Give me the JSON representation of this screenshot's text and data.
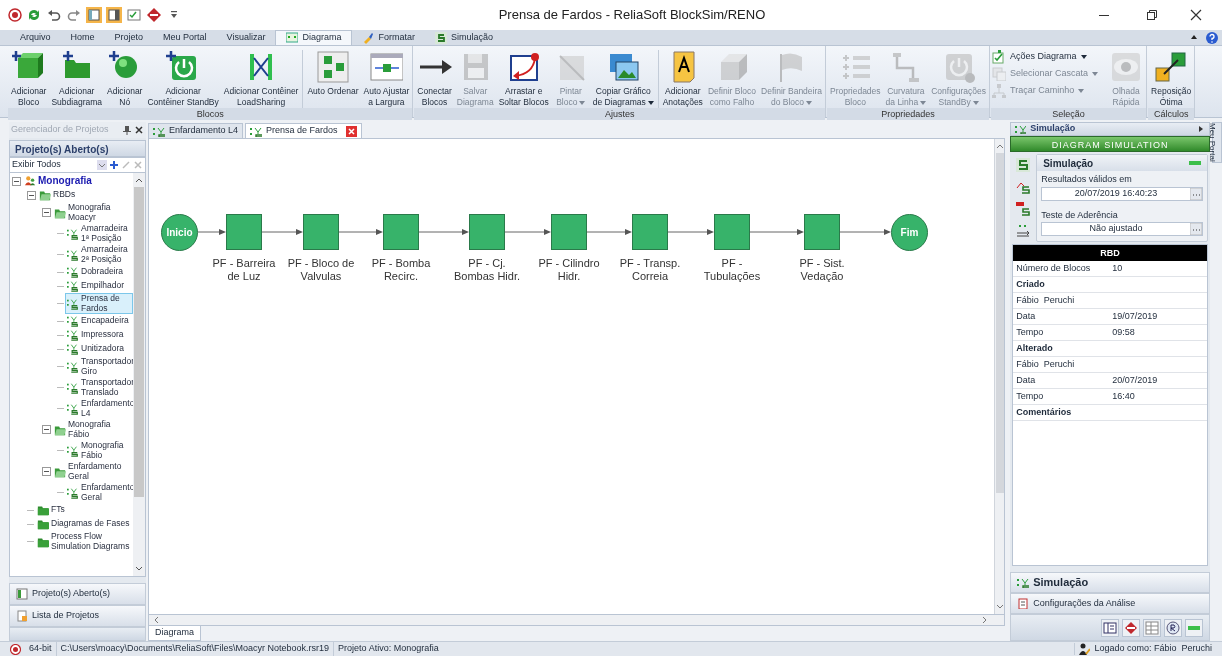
{
  "window": {
    "title": "Prensa de Fardos - ReliaSoft BlockSim/RENO"
  },
  "menu_tabs": [
    {
      "label": "Arquivo",
      "selected": false
    },
    {
      "label": "Home",
      "selected": false
    },
    {
      "label": "Projeto",
      "selected": false
    },
    {
      "label": "Meu Portal",
      "selected": false
    },
    {
      "label": "Visualizar",
      "selected": false
    },
    {
      "label": "Diagrama",
      "selected": true
    },
    {
      "label": "Formatar",
      "selected": false
    },
    {
      "label": "Simulação",
      "selected": false
    }
  ],
  "ribbon": [
    {
      "label": "Blocos",
      "buttons": [
        {
          "kind": "large",
          "label": "Adicionar\nBloco",
          "disabled": false,
          "dropdown": false
        },
        {
          "kind": "large",
          "label": "Adicionar\nSubdiagrama",
          "disabled": false,
          "dropdown": false
        },
        {
          "kind": "large",
          "label": "Adicionar\nNó",
          "disabled": false,
          "dropdown": false
        },
        {
          "kind": "large",
          "label": "Adicionar\nContêiner StandBy",
          "disabled": false,
          "dropdown": false
        },
        {
          "kind": "large",
          "label": "Adicionar Contêiner\nLoadSharing",
          "disabled": false,
          "dropdown": false
        },
        {
          "kind": "large",
          "label": "Auto Ordenar",
          "disabled": false,
          "dropdown": false
        },
        {
          "kind": "large",
          "label": "Auto Ajustar\na Largura",
          "disabled": false,
          "dropdown": false
        }
      ]
    },
    {
      "label": "Ajustes",
      "buttons": [
        {
          "kind": "large",
          "label": "Conectar\nBlocos",
          "disabled": false,
          "dropdown": false
        },
        {
          "kind": "large",
          "label": "Salvar\nDiagrama",
          "disabled": true,
          "dropdown": false
        },
        {
          "kind": "large",
          "label": "Arrastar e\nSoltar Blocos",
          "disabled": false,
          "dropdown": false
        },
        {
          "kind": "large",
          "label": "Pintar\nBloco",
          "disabled": true,
          "dropdown": true
        },
        {
          "kind": "large",
          "label": "Copiar Gráfico\nde Diagramas",
          "disabled": false,
          "dropdown": true
        },
        {
          "kind": "large",
          "label": "Adicionar\nAnotações",
          "disabled": false,
          "dropdown": false
        },
        {
          "kind": "large",
          "label": "Definir Bloco\ncomo Falho",
          "disabled": true,
          "dropdown": false
        },
        {
          "kind": "large",
          "label": "Definir Bandeira\ndo Bloco",
          "disabled": true,
          "dropdown": true
        }
      ]
    },
    {
      "label": "Propriedades",
      "buttons": [
        {
          "kind": "large",
          "label": "Propriedades\nBloco",
          "disabled": true,
          "dropdown": false
        },
        {
          "kind": "large",
          "label": "Curvatura\nda Linha",
          "disabled": true,
          "dropdown": true
        },
        {
          "kind": "large",
          "label": "Configurações\nStandBy",
          "disabled": true,
          "dropdown": true
        }
      ]
    },
    {
      "label": "Seleção",
      "buttons": [
        {
          "kind": "small",
          "label": "Ações Diagrama",
          "disabled": false,
          "dropdown": true
        },
        {
          "kind": "small",
          "label": "Selecionar Cascata",
          "disabled": true,
          "dropdown": true
        },
        {
          "kind": "small",
          "label": "Traçar Caminho",
          "disabled": true,
          "dropdown": true
        },
        {
          "kind": "large",
          "label": "Olhada\nRápida",
          "disabled": true,
          "dropdown": false
        }
      ]
    },
    {
      "label": "Cálculos",
      "buttons": [
        {
          "kind": "large",
          "label": "Reposição\nÓtima",
          "disabled": false,
          "dropdown": false
        }
      ]
    }
  ],
  "project_panel": {
    "title": "Gerenciador de Projetos",
    "header": "Projeto(s) Aberto(s)",
    "filter": "Exibir Todos",
    "tree": [
      {
        "label": "Monografia",
        "kind": "project",
        "expanded": true,
        "selected": false,
        "children": [
          {
            "label": "RBDs",
            "kind": "folder",
            "expanded": true,
            "selected": false,
            "children": [
              {
                "label": "Monografia Moacyr",
                "kind": "folder",
                "expanded": true,
                "selected": false,
                "children": [
                  {
                    "label": "Amarradeira 1ª Posição",
                    "kind": "diagram",
                    "selected": false
                  },
                  {
                    "label": "Amarradeira 2ª Posição",
                    "kind": "diagram",
                    "selected": false
                  },
                  {
                    "label": "Dobradeira",
                    "kind": "diagram",
                    "selected": false
                  },
                  {
                    "label": "Empilhador",
                    "kind": "diagram",
                    "selected": false
                  },
                  {
                    "label": "Prensa de Fardos",
                    "kind": "diagram",
                    "selected": true
                  },
                  {
                    "label": "Encapadeira",
                    "kind": "diagram",
                    "selected": false
                  },
                  {
                    "label": "Impressora",
                    "kind": "diagram",
                    "selected": false
                  },
                  {
                    "label": "Unitizadora",
                    "kind": "diagram",
                    "selected": false
                  },
                  {
                    "label": "Transportador Giro",
                    "kind": "diagram",
                    "selected": false
                  },
                  {
                    "label": "Transportador Translado",
                    "kind": "diagram",
                    "selected": false
                  },
                  {
                    "label": "Enfardamento L4",
                    "kind": "diagram",
                    "selected": false
                  }
                ]
              },
              {
                "label": "Monografia Fábio",
                "kind": "folder",
                "expanded": true,
                "selected": false,
                "children": [
                  {
                    "label": "Monografia Fábio",
                    "kind": "diagram",
                    "selected": false
                  }
                ]
              },
              {
                "label": "Enfardamento Geral",
                "kind": "folder",
                "expanded": true,
                "selected": false,
                "children": [
                  {
                    "label": "Enfardamento Geral",
                    "kind": "diagram",
                    "selected": false
                  }
                ]
              }
            ]
          },
          {
            "label": "FTs",
            "kind": "group",
            "selected": false
          },
          {
            "label": "Diagramas de Fases",
            "kind": "group",
            "selected": false
          },
          {
            "label": "Process Flow Simulation Diagrams",
            "kind": "group",
            "selected": false
          }
        ]
      }
    ],
    "nav": [
      {
        "label": "Projeto(s) Aberto(s)",
        "selected": false
      },
      {
        "label": "Lista de Projetos",
        "selected": false
      }
    ]
  },
  "doc_tabs": [
    {
      "label": "Enfardamento L4",
      "selected": false
    },
    {
      "label": "Prensa de Fardos",
      "selected": true
    }
  ],
  "diagram": {
    "start": "Inicio",
    "end": "Fim",
    "blocks": [
      "PF - Barreira de Luz",
      "PF - Bloco de Valvulas",
      "PF - Bomba Recirc.",
      "PF - Cj. Bombas Hidr.",
      "PF - Cilindro Hidr.",
      "PF - Transp. Correia",
      "PF - Tubulações",
      "PF - Sist. Vedação"
    ]
  },
  "bottom_tab": "Diagrama",
  "simulation_panel": {
    "title": "Simulação",
    "banner": "DIAGRAM SIMULATION",
    "section": "Simulação",
    "valid_label": "Resultados válidos em",
    "valid_value": "20/07/2019 16:40:23",
    "fit_label": "Teste de Aderência",
    "fit_value": "Não ajustado",
    "table_title": "RBD",
    "rows": [
      {
        "kind": "pair",
        "label": "Número de Blocos",
        "value": "10"
      },
      {
        "kind": "section",
        "label": "Criado"
      },
      {
        "kind": "text",
        "label": "Fábio  Peruchi"
      },
      {
        "kind": "pair",
        "label": "Data",
        "value": "19/07/2019"
      },
      {
        "kind": "pair",
        "label": "Tempo",
        "value": "09:58"
      },
      {
        "kind": "section",
        "label": "Alterado"
      },
      {
        "kind": "text",
        "label": "Fábio  Peruchi"
      },
      {
        "kind": "pair",
        "label": "Data",
        "value": "20/07/2019"
      },
      {
        "kind": "pair",
        "label": "Tempo",
        "value": "16:40"
      },
      {
        "kind": "section",
        "label": "Comentários"
      }
    ],
    "nav": [
      {
        "label": "Simulação",
        "selected": true
      },
      {
        "label": "Configurações da Análise",
        "selected": false
      }
    ]
  },
  "side_tab": "Meu Portal",
  "status_bar": {
    "bits": "64-bit",
    "path": "C:\\Users\\moacy\\Documents\\ReliaSoft\\Files\\Moacyr Notebook.rsr19",
    "active": "Projeto Ativo: Monografia",
    "user": "Logado como: Fábio  Peruchi"
  }
}
